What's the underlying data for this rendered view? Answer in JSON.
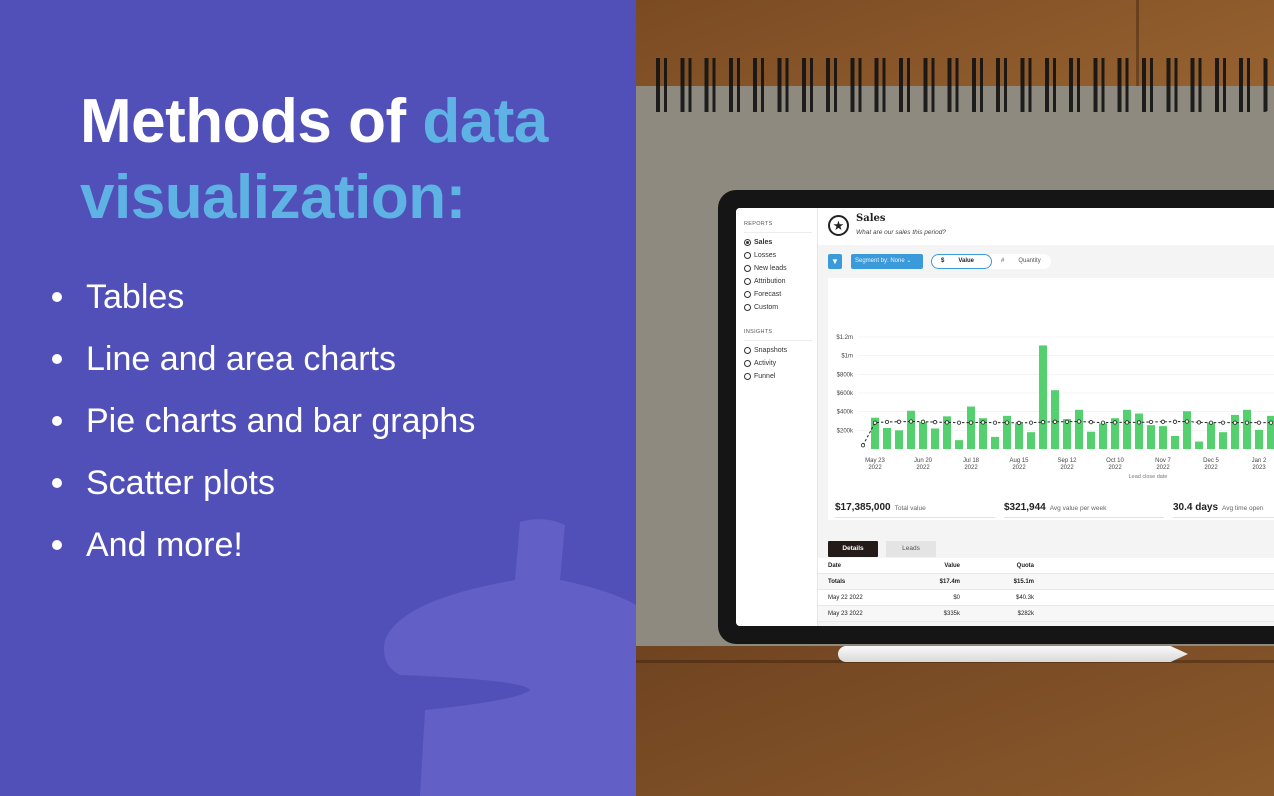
{
  "headline": {
    "part1": "Methods of ",
    "highlight": "data visualization:"
  },
  "methods": [
    "Tables",
    "Line and area charts",
    "Pie charts and bar graphs",
    "Scatter plots",
    "And more!"
  ],
  "colors": {
    "background": "#5150b8",
    "highlight": "#5fb3e4",
    "bars": "#55d06e",
    "accent": "#3b9ad9"
  },
  "dashboard": {
    "sidebar": {
      "reports_heading": "REPORTS",
      "reports": [
        {
          "label": "Sales",
          "icon": "target-icon",
          "active": true
        },
        {
          "label": "Losses",
          "icon": "prohibited-icon"
        },
        {
          "label": "New leads",
          "icon": "pie-icon"
        },
        {
          "label": "Attribution",
          "icon": "tag-icon"
        },
        {
          "label": "Forecast",
          "icon": "ellipsis-icon"
        },
        {
          "label": "Custom",
          "icon": "target-icon"
        }
      ],
      "insights_heading": "INSIGHTS",
      "insights": [
        {
          "label": "Snapshots",
          "icon": "smile-icon"
        },
        {
          "label": "Activity",
          "icon": "check-icon"
        },
        {
          "label": "Funnel",
          "icon": "funnel-icon"
        }
      ]
    },
    "header": {
      "title": "Sales",
      "subtitle": "What are our sales this period?",
      "icon": "star-icon"
    },
    "toolbar": {
      "segment_label": "Segment by: None",
      "value_symbol": "$",
      "value_label": "Value",
      "quantity_symbol": "#",
      "quantity_label": "Quantity",
      "selected": "Value"
    },
    "stats": [
      {
        "value": "$17,385,000",
        "label": "Total value"
      },
      {
        "value": "$321,944",
        "label": "Avg value per week"
      },
      {
        "value": "30.4 days",
        "label": "Avg time open"
      }
    ],
    "tabs": [
      "Details",
      "Leads"
    ],
    "active_tab": "Details",
    "table": {
      "columns": [
        "Date",
        "Value",
        "Quota"
      ],
      "rows": [
        [
          "Totals",
          "$17.4m",
          "$15.1m"
        ],
        [
          "May 22 2022",
          "$0",
          "$40.3k"
        ],
        [
          "May 23 2022",
          "$335k",
          "$282k"
        ]
      ]
    }
  },
  "chart_data": {
    "type": "bar",
    "xlabel": "Lead close date",
    "ylabel": "",
    "ylim": [
      0,
      1200000
    ],
    "y_ticks": [
      "$200k",
      "$400k",
      "$600k",
      "$800k",
      "$1m",
      "$1.2m"
    ],
    "y_tick_values": [
      200000,
      400000,
      600000,
      800000,
      1000000,
      1200000
    ],
    "x_tick_labels": [
      [
        "May 23",
        "2022"
      ],
      [
        "Jun 20",
        "2022"
      ],
      [
        "Jul 18",
        "2022"
      ],
      [
        "Aug 15",
        "2022"
      ],
      [
        "Sep 12",
        "2022"
      ],
      [
        "Oct 10",
        "2022"
      ],
      [
        "Nov 7",
        "2022"
      ],
      [
        "Dec 5",
        "2022"
      ],
      [
        "Jan 2",
        "2023"
      ]
    ],
    "x_tick_every": 4,
    "x_tick_start_index": 1,
    "grid": true,
    "series": [
      {
        "type": "bar",
        "values": [
          0,
          335000,
          225000,
          200000,
          410000,
          290000,
          220000,
          350000,
          95000,
          455000,
          330000,
          130000,
          355000,
          275000,
          180000,
          1110000,
          630000,
          320000,
          420000,
          185000,
          275000,
          330000,
          420000,
          380000,
          255000,
          245000,
          140000,
          405000,
          80000,
          285000,
          180000,
          365000,
          420000,
          205000,
          355000
        ]
      },
      {
        "type": "line",
        "style": "dashed-with-markers",
        "values": [
          40300,
          282000,
          290000,
          292000,
          295000,
          292000,
          288000,
          285000,
          282000,
          283000,
          285000,
          282000,
          283000,
          280000,
          282000,
          288000,
          292000,
          292000,
          295000,
          288000,
          282000,
          285000,
          285000,
          285000,
          290000,
          292000,
          292000,
          295000,
          285000,
          282000,
          282000,
          282000,
          282000,
          282000,
          282000
        ]
      }
    ]
  }
}
